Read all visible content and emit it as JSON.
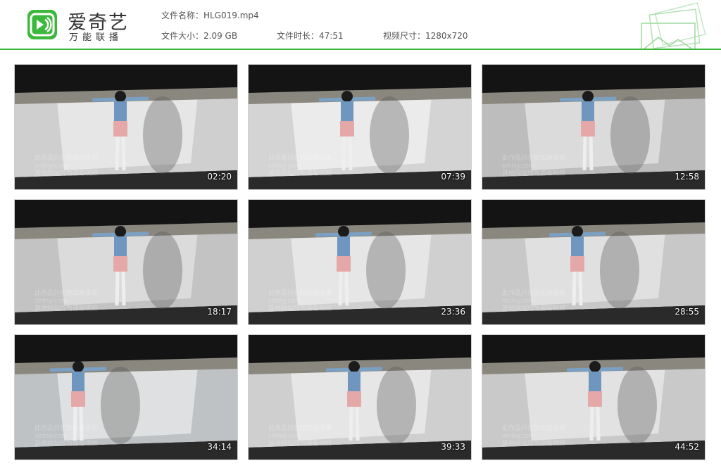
{
  "brand": {
    "name": "爱奇艺",
    "tagline": "万能联播",
    "accent": "#3cb93c"
  },
  "file_info": {
    "name_label": "文件名称：",
    "name_value": "HLG019.mp4",
    "size_label": "文件大小：",
    "size_value": "2.09 GB",
    "duration_label": "文件时长：",
    "duration_value": "47:51",
    "dims_label": "视频尺寸：",
    "dims_value": "1280x720"
  },
  "watermark": {
    "line1": "此作品只在颜如画发表",
    "line2": "smlsy.com",
    "line3": "其他网站均为盗版视频"
  },
  "thumbnails": [
    {
      "time": "02:20"
    },
    {
      "time": "07:39"
    },
    {
      "time": "12:58"
    },
    {
      "time": "18:17"
    },
    {
      "time": "23:36"
    },
    {
      "time": "28:55"
    },
    {
      "time": "34:14"
    },
    {
      "time": "39:33"
    },
    {
      "time": "44:52"
    }
  ]
}
